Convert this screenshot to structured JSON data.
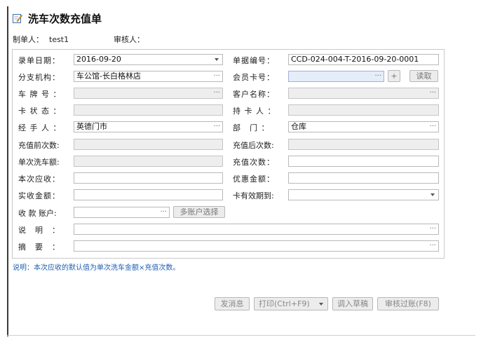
{
  "title": "洗车次数充值单",
  "meta": {
    "creator_label": "制单人：",
    "creator_value": "test1",
    "reviewer_label": "审核人："
  },
  "fields": {
    "entry_date": {
      "label": "录单日期：",
      "value": "2016-09-20"
    },
    "doc_no": {
      "label": "单据编号：",
      "value": "CCD-024-004-T-2016-09-20-0001"
    },
    "branch": {
      "label": "分支机构：",
      "value": "车公馆-长白格林店"
    },
    "member_card": {
      "label": "会员卡号：",
      "value": ""
    },
    "plate_no": {
      "label": "车 牌 号 ：",
      "value": ""
    },
    "customer_name": {
      "label": "客户名称：",
      "value": ""
    },
    "card_status": {
      "label": "卡 状 态 ：",
      "value": ""
    },
    "card_holder": {
      "label": "持 卡 人 ：",
      "value": ""
    },
    "handler": {
      "label": "经 手 人 ：",
      "value": "英德门市"
    },
    "department": {
      "label": "部　门 ：",
      "value": "仓库"
    },
    "count_before": {
      "label": "充值前次数:",
      "value": ""
    },
    "count_after": {
      "label": "充值后次数:",
      "value": ""
    },
    "unit_price": {
      "label": "单次洗车额:",
      "value": ""
    },
    "recharge_count": {
      "label": "充值次数：",
      "value": ""
    },
    "payable": {
      "label": "本次应收：",
      "value": ""
    },
    "discount": {
      "label": "优惠金额：",
      "value": ""
    },
    "actual_received": {
      "label": "实收金额：",
      "value": ""
    },
    "card_expiry": {
      "label": "卡有效期到:",
      "value": ""
    },
    "payment_account": {
      "label": "收 款 账户:",
      "value": ""
    },
    "description": {
      "label": "说　明　：",
      "value": ""
    },
    "summary": {
      "label": "摘　要　：",
      "value": ""
    }
  },
  "buttons": {
    "add": "+",
    "read": "读取",
    "multi_account": "多账户选择",
    "send_message": "发消息",
    "print": "打印(Ctrl+F9)",
    "load_draft": "调入草稿",
    "review_post": "审核过账(F8)"
  },
  "note": "说明：本次应收的默认值为单次洗车金额×充值次数。",
  "colors": {
    "note_text": "#1f5fb3",
    "readonly_bg": "#eeeeee",
    "highlight_bg": "#e4edf9"
  },
  "icons": [
    "edit-document-icon",
    "ellipsis-icon",
    "dropdown-arrow-icon",
    "print-dropdown-icon"
  ]
}
